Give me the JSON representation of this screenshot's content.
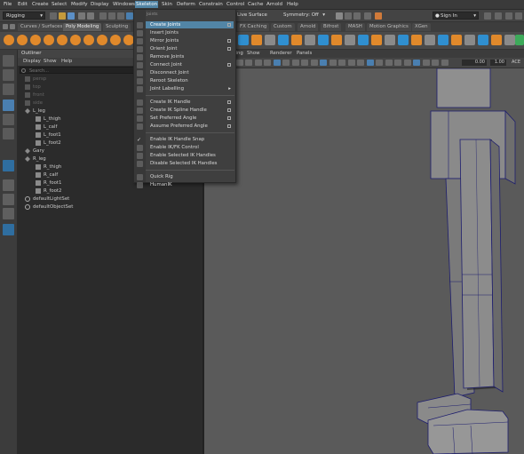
{
  "menubar": {
    "items": [
      "File",
      "Edit",
      "Create",
      "Select",
      "Modify",
      "Display",
      "Windows",
      "Skeleton",
      "Skin",
      "Deform",
      "Constrain",
      "Control",
      "Cache",
      "Arnold",
      "Help"
    ],
    "active": "Skeleton"
  },
  "status": {
    "mode": "Rigging",
    "live_surface": "Live Surface",
    "symmetry": "Symmetry: Off",
    "sign_in": "Sign In"
  },
  "shelf_tabs": [
    "Curves / Surfaces",
    "Poly Modeling",
    "Sculpting",
    "FX Caching",
    "Custom",
    "Arnold",
    "Bifrost",
    "MASH",
    "Motion Graphics",
    "XGen"
  ],
  "shelf_tabs_active": "Poly Modeling",
  "outliner": {
    "title": "Outliner",
    "menu": [
      "Display",
      "Show",
      "Help"
    ],
    "search_placeholder": "Search...",
    "rows": [
      {
        "label": "persp",
        "indent": 0,
        "dim": true
      },
      {
        "label": "top",
        "indent": 0,
        "dim": true
      },
      {
        "label": "front",
        "indent": 0,
        "dim": true
      },
      {
        "label": "side",
        "indent": 0,
        "dim": true
      },
      {
        "label": "L_leg",
        "indent": 0,
        "dim": false
      },
      {
        "label": "L_thigh",
        "indent": 1,
        "dim": false
      },
      {
        "label": "L_calf",
        "indent": 1,
        "dim": false
      },
      {
        "label": "L_foot1",
        "indent": 1,
        "dim": false
      },
      {
        "label": "L_foot2",
        "indent": 1,
        "dim": false
      },
      {
        "label": "Gary",
        "indent": 0,
        "dim": false
      },
      {
        "label": "R_leg",
        "indent": 0,
        "dim": false
      },
      {
        "label": "R_thigh",
        "indent": 1,
        "dim": false
      },
      {
        "label": "R_calf",
        "indent": 1,
        "dim": false
      },
      {
        "label": "R_foot1",
        "indent": 1,
        "dim": false
      },
      {
        "label": "R_foot2",
        "indent": 1,
        "dim": false
      },
      {
        "label": "defaultLightSet",
        "indent": 0,
        "dim": false
      },
      {
        "label": "defaultObjectSet",
        "indent": 0,
        "dim": false
      }
    ]
  },
  "viewport": {
    "menu": [
      "Lighting",
      "Show",
      "Renderer",
      "Panels"
    ],
    "field1": "0.00",
    "field2": "1.00",
    "colorspace": "ACE"
  },
  "skeleton_menu": {
    "header": "Joints",
    "groups": [
      [
        {
          "label": "Create Joints",
          "option": true,
          "highlight": true
        },
        {
          "label": "Insert Joints",
          "option": false
        },
        {
          "label": "Mirror Joints",
          "option": true
        },
        {
          "label": "Orient Joint",
          "option": true
        },
        {
          "label": "Remove Joints",
          "option": false
        },
        {
          "label": "Connect Joint",
          "option": true
        },
        {
          "label": "Disconnect Joint",
          "option": false
        },
        {
          "label": "Reroot Skeleton",
          "option": false
        },
        {
          "label": "Joint Labelling",
          "option": false,
          "submenu": true
        }
      ],
      [
        {
          "label": "Create IK Handle",
          "option": true
        },
        {
          "label": "Create IK Spline Handle",
          "option": true
        },
        {
          "label": "Set Preferred Angle",
          "option": true
        },
        {
          "label": "Assume Preferred Angle",
          "option": true
        }
      ],
      [
        {
          "label": "Enable IK Handle Snap",
          "option": false,
          "checked": true
        },
        {
          "label": "Enable IK/FK Control",
          "option": false
        },
        {
          "label": "Enable Selected IK Handles",
          "option": false
        },
        {
          "label": "Disable Selected IK Handles",
          "option": false
        }
      ],
      [
        {
          "label": "Quick Rig",
          "option": false
        },
        {
          "label": "HumanIK",
          "option": false
        }
      ]
    ],
    "submenu_arrow": "▸",
    "check_glyph": "✓"
  },
  "colors": {
    "highlight": "#5285a6",
    "viewport_bg": "#5a5a5a",
    "mesh_fill": "#8a8a8a",
    "wire": "#1d1d6e",
    "shelf_orange": "#e0892b",
    "shelf_blue": "#2f8fd0"
  }
}
